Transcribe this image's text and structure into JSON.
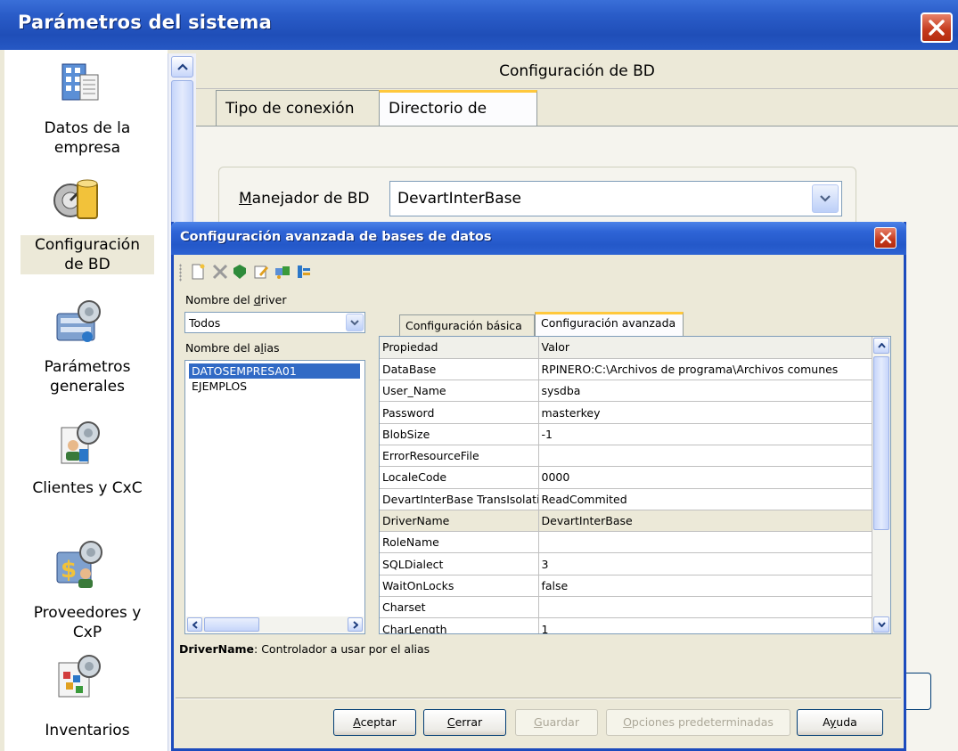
{
  "main_window": {
    "title": "Parámetros del sistema",
    "sidebar": [
      {
        "label": "Datos de la\nempresa",
        "icon": "building-document-icon"
      },
      {
        "label": "Configuración\nde BD",
        "icon": "database-icon",
        "selected": true
      },
      {
        "label": "Parámetros\ngenerales",
        "icon": "settings-server-icon"
      },
      {
        "label": "Clientes y CxC",
        "icon": "customer-icon"
      },
      {
        "label": "Proveedores y\nCxP",
        "icon": "supplier-icon"
      },
      {
        "label": "Inventarios",
        "icon": "inventory-icon"
      }
    ],
    "panel_title": "Configuración de BD",
    "tabs": [
      "Tipo de conexión",
      "Directorio de datos"
    ],
    "active_tab": 1,
    "manager_label_prefix": "M",
    "manager_label_rest": "anejador de BD",
    "manager_value": "DevartInterBase"
  },
  "dialog": {
    "title": "Configuración avanzada de bases de datos",
    "toolbar_icons": [
      "new-icon",
      "delete-icon",
      "apply-icon",
      "edit-icon",
      "test-connection-icon",
      "properties-icon"
    ],
    "driver_label_prefix": "Nombre del ",
    "driver_label_u": "d",
    "driver_label_rest": "river",
    "driver_value": "Todos",
    "alias_label_prefix": "Nombre del a",
    "alias_label_u": "l",
    "alias_label_rest": "ias",
    "aliases": [
      "DATOSEMPRESA01",
      "EJEMPLOS"
    ],
    "selected_alias": 0,
    "tabs": [
      "Configuración básica",
      "Configuración avanzada"
    ],
    "active_tab": 1,
    "grid_headers": [
      "Propiedad",
      "Valor"
    ],
    "grid_rows": [
      [
        "DataBase",
        "RPINERO:C:\\Archivos de programa\\Archivos comunes"
      ],
      [
        "User_Name",
        "sysdba"
      ],
      [
        "Password",
        "masterkey"
      ],
      [
        "BlobSize",
        "-1"
      ],
      [
        "ErrorResourceFile",
        ""
      ],
      [
        "LocaleCode",
        "0000"
      ],
      [
        "DevartInterBase TransIsolation",
        "ReadCommited"
      ],
      [
        "DriverName",
        "DevartInterBase"
      ],
      [
        "RoleName",
        ""
      ],
      [
        "SQLDialect",
        "3"
      ],
      [
        "WaitOnLocks",
        "false"
      ],
      [
        "Charset",
        ""
      ],
      [
        "CharLength",
        "1"
      ]
    ],
    "selected_row": 7,
    "hint_bold": "DriverName",
    "hint_text": ": Controlador a usar por el alias",
    "buttons": [
      {
        "u": "A",
        "rest": "ceptar",
        "enabled": true
      },
      {
        "u": "C",
        "rest": "errar",
        "enabled": true
      },
      {
        "u": "G",
        "rest": "uardar",
        "enabled": false
      },
      {
        "u": "O",
        "rest": "pciones predeterminadas",
        "enabled": false
      },
      {
        "pre": "A",
        "u": "y",
        "rest": "uda",
        "enabled": true
      }
    ]
  }
}
